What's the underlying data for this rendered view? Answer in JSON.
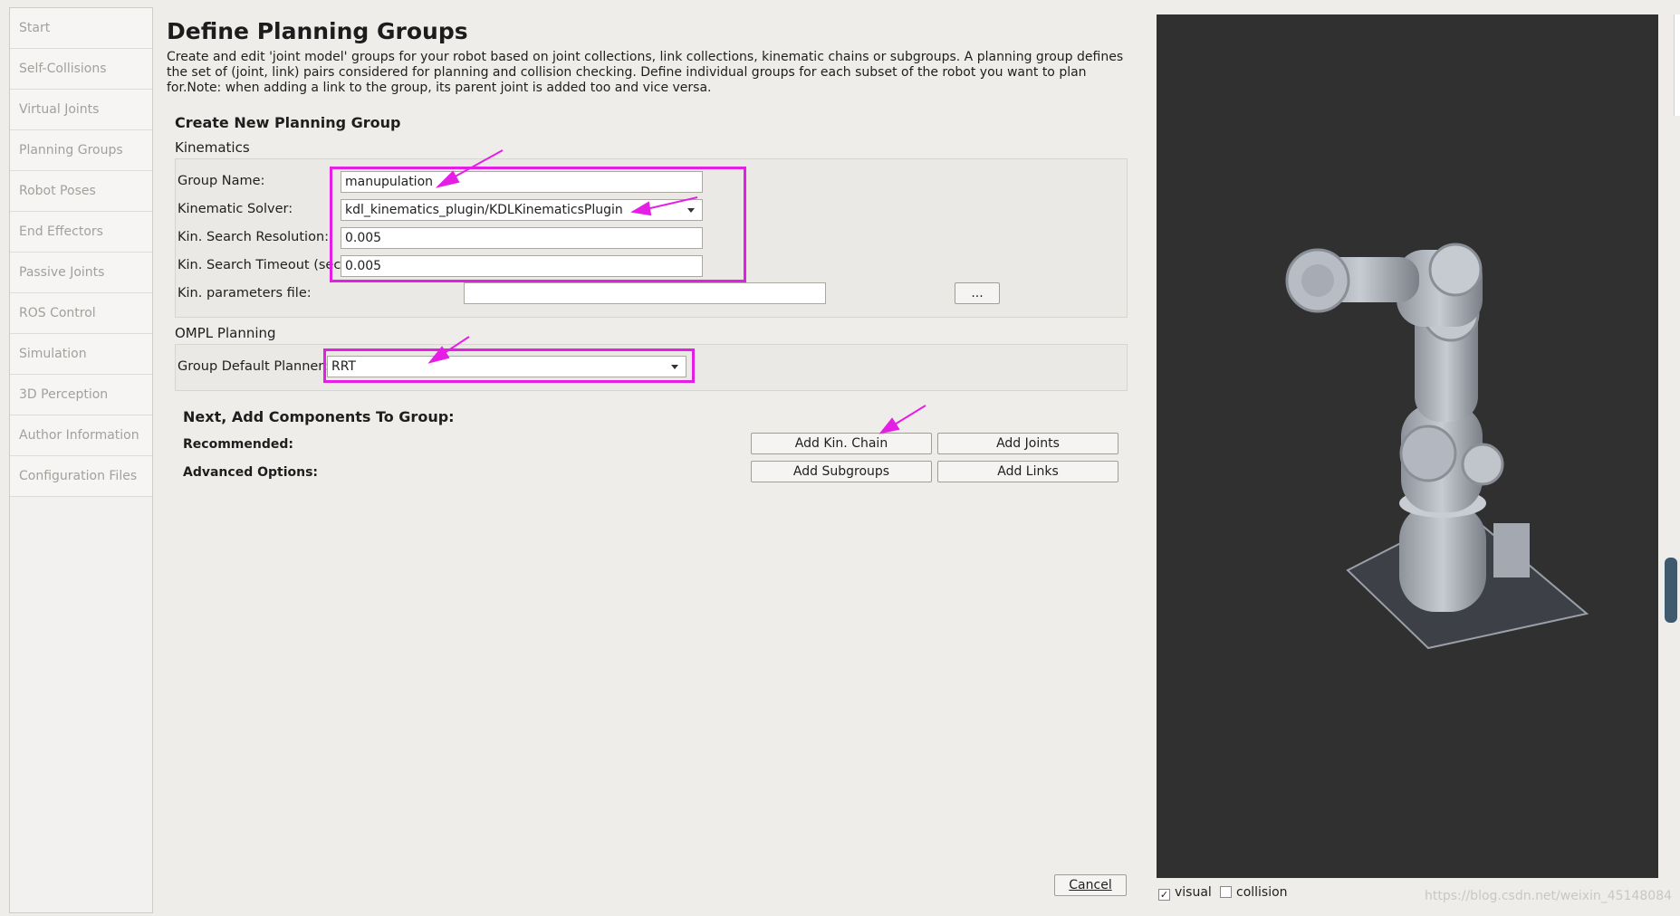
{
  "sidebar": {
    "items": [
      {
        "label": "Start",
        "name": "sidebar-item-start"
      },
      {
        "label": "Self-Collisions",
        "name": "sidebar-item-self-collisions"
      },
      {
        "label": "Virtual Joints",
        "name": "sidebar-item-virtual-joints"
      },
      {
        "label": "Planning Groups",
        "name": "sidebar-item-planning-groups"
      },
      {
        "label": "Robot Poses",
        "name": "sidebar-item-robot-poses"
      },
      {
        "label": "End Effectors",
        "name": "sidebar-item-end-effectors"
      },
      {
        "label": "Passive Joints",
        "name": "sidebar-item-passive-joints"
      },
      {
        "label": "ROS Control",
        "name": "sidebar-item-ros-control"
      },
      {
        "label": "Simulation",
        "name": "sidebar-item-simulation"
      },
      {
        "label": "3D Perception",
        "name": "sidebar-item-3d-perception"
      },
      {
        "label": "Author Information",
        "name": "sidebar-item-author-information"
      },
      {
        "label": "Configuration Files",
        "name": "sidebar-item-configuration-files"
      }
    ]
  },
  "main": {
    "title": "Define Planning Groups",
    "description": "Create and edit 'joint model' groups for your robot based on joint collections, link collections, kinematic chains or subgroups. A planning group defines the set of (joint, link) pairs considered for planning and collision checking. Define individual groups for each subset of the robot you want to plan for.Note: when adding a link to the group, its parent joint is added too and vice versa.",
    "section_title": "Create New Planning Group",
    "kinematics": {
      "heading": "Kinematics",
      "group_name_label": "Group Name:",
      "group_name_value": "manupulation",
      "solver_label": "Kinematic Solver:",
      "solver_value": "kdl_kinematics_plugin/KDLKinematicsPlugin",
      "resolution_label": "Kin. Search Resolution:",
      "resolution_value": "0.005",
      "timeout_label": "Kin. Search Timeout (sec):",
      "timeout_value": "0.005",
      "params_label": "Kin. parameters file:",
      "params_value": "",
      "browse_label": "..."
    },
    "ompl": {
      "heading": "OMPL Planning",
      "planner_label": "Group Default Planner:",
      "planner_value": "RRT"
    },
    "components": {
      "heading": "Next, Add Components To Group:",
      "recommended_label": "Recommended:",
      "advanced_label": "Advanced Options:",
      "add_kin_chain": "Add Kin. Chain",
      "add_joints": "Add Joints",
      "add_subgroups": "Add Subgroups",
      "add_links": "Add Links"
    },
    "cancel_label": "Cancel"
  },
  "viewer": {
    "visual_label": "visual",
    "visual_checked": true,
    "collision_label": "collision",
    "collision_checked": false,
    "watermark": "https://blog.csdn.net/weixin_45148084"
  },
  "colors": {
    "highlight": "#e51ee5",
    "viewer_bg": "#303030",
    "robot": "#b9bdc4"
  }
}
